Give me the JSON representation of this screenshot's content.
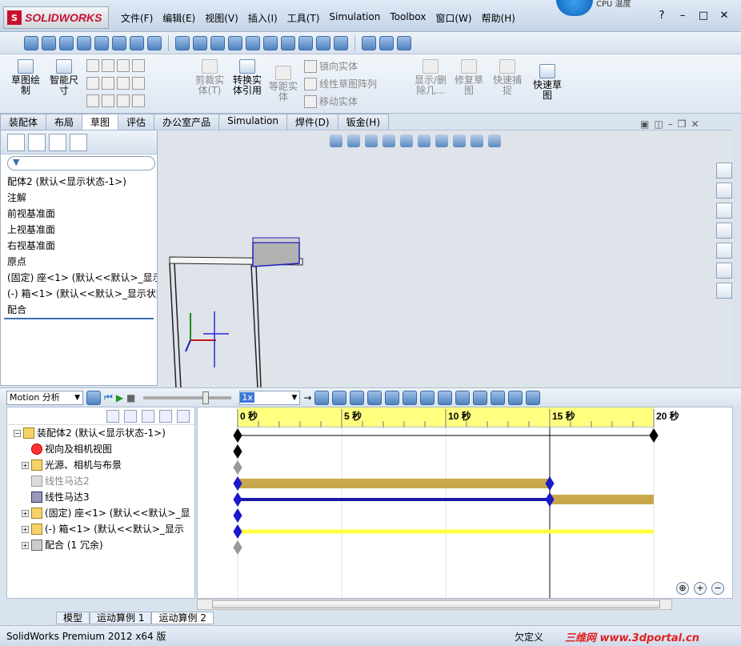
{
  "app": {
    "logo": "SOLIDWORKS",
    "logo_mark": "S"
  },
  "menus": [
    "文件(F)",
    "编辑(E)",
    "视图(V)",
    "插入(I)",
    "工具(T)",
    "Simulation",
    "Toolbox",
    "窗口(W)",
    "帮助(H)"
  ],
  "cpu_label": "CPU 温度",
  "ribbon": {
    "sketch": "草图绘制",
    "smart_dim": "智能尺寸",
    "trim": "剪裁实体(T)",
    "convert": "转换实体引用",
    "offset": "等距实体",
    "mirror": "镜向实体",
    "linear_pattern": "线性草图阵列",
    "move": "移动实体",
    "show_hide": "显示/删除几...",
    "repair": "修复草图",
    "quick_snap": "快速捕捉",
    "rapid_sketch": "快速草图"
  },
  "tabs": [
    "装配体",
    "布局",
    "草图",
    "评估",
    "办公室产品",
    "Simulation",
    "焊件(D)",
    "钣金(H)"
  ],
  "active_tab": "草图",
  "feature_tree": [
    "配体2 (默认<显示状态-1>)",
    "注解",
    "前视基准面",
    "上视基准面",
    "右视基准面",
    "原点",
    "(固定) 座<1> (默认<<默认>_显示",
    "(-) 箱<1> (默认<<默认>_显示状态",
    "配合"
  ],
  "motion": {
    "study_type": "Motion 分析",
    "speed": "1x",
    "tree": [
      {
        "label": "装配体2 (默认<显示状态-1>)",
        "gray": false
      },
      {
        "label": "视向及相机视图",
        "gray": false
      },
      {
        "label": "光源、相机与布景",
        "gray": false
      },
      {
        "label": "线性马达2",
        "gray": true
      },
      {
        "label": "线性马达3",
        "gray": false
      },
      {
        "label": "(固定) 座<1> (默认<<默认>_显",
        "gray": false
      },
      {
        "label": "(-) 箱<1> (默认<<默认>_显示",
        "gray": false
      },
      {
        "label": "配合 (1 冗余)",
        "gray": false
      }
    ],
    "ticks": [
      "0 秒",
      "5 秒",
      "10 秒",
      "15 秒",
      "20 秒"
    ],
    "colors": {
      "motor2": "#c8a64b",
      "motor3_a": "#1a1aa8",
      "motor3_b": "#c8a64b",
      "box": "#ffff40",
      "key": "#1a1ac8"
    }
  },
  "bottom_tabs": [
    "模型",
    "运动算例 1",
    "运动算例 2"
  ],
  "active_bottom_tab": "运动算例 2",
  "status": {
    "left": "SolidWorks Premium 2012 x64 版",
    "mid": "欠定义",
    "watermark": "三维网 www.3dportal.cn"
  }
}
